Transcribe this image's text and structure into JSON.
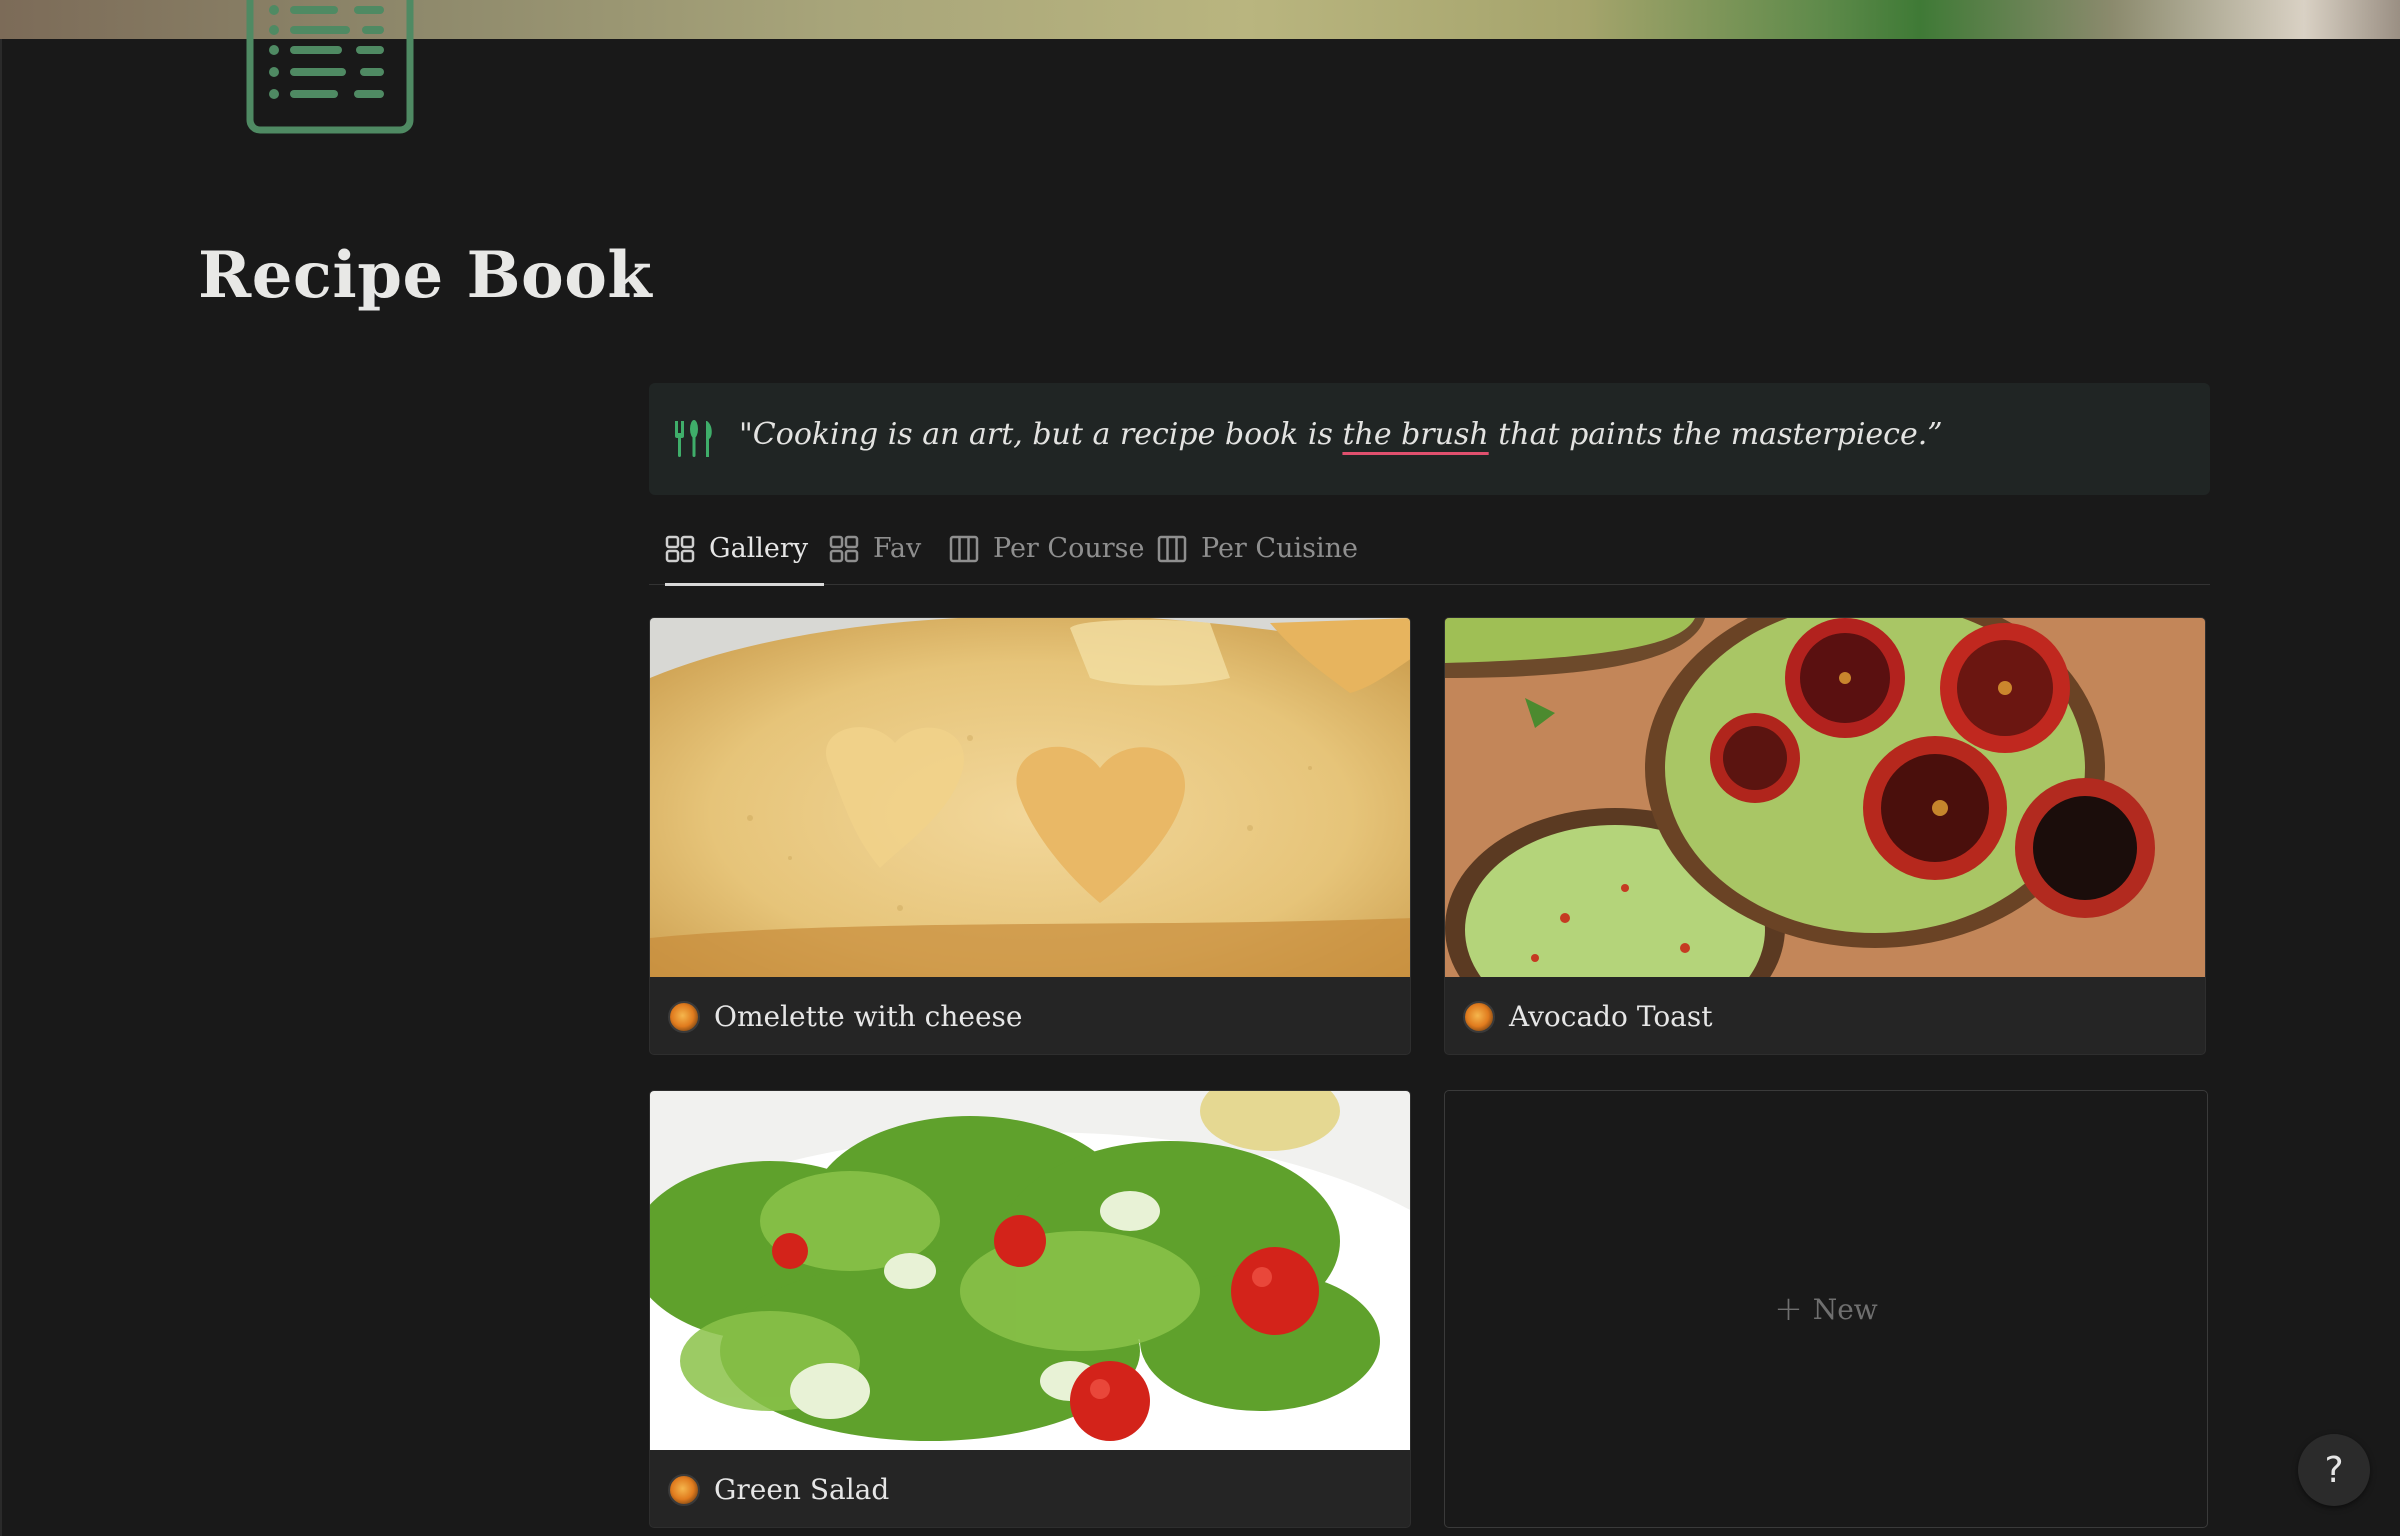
{
  "page": {
    "title": "Recipe Book"
  },
  "callout": {
    "icon": "fork-knife-icon",
    "text_before": "\"Cooking is an art, but a recipe book is ",
    "text_underlined": "the brush",
    "text_after": " that paints the masterpiece.”"
  },
  "tabs": [
    {
      "label": "Gallery",
      "icon": "gallery-icon",
      "active": true
    },
    {
      "label": "Fav",
      "icon": "gallery-icon",
      "active": false
    },
    {
      "label": "Per Course",
      "icon": "board-icon",
      "active": false
    },
    {
      "label": "Per Cuisine",
      "icon": "board-icon",
      "active": false
    }
  ],
  "cards": [
    {
      "title": "Omelette with cheese",
      "image": "omelette-image"
    },
    {
      "title": "Avocado Toast",
      "image": "avocado-toast-image"
    },
    {
      "title": "Green Salad",
      "image": "green-salad-image"
    }
  ],
  "new_card": {
    "label": "New"
  },
  "help": {
    "label": "?"
  },
  "colors": {
    "background": "#191919",
    "callout_bg": "#202524",
    "accent_green": "#5d9a72",
    "underline_pink": "#e0506e"
  }
}
